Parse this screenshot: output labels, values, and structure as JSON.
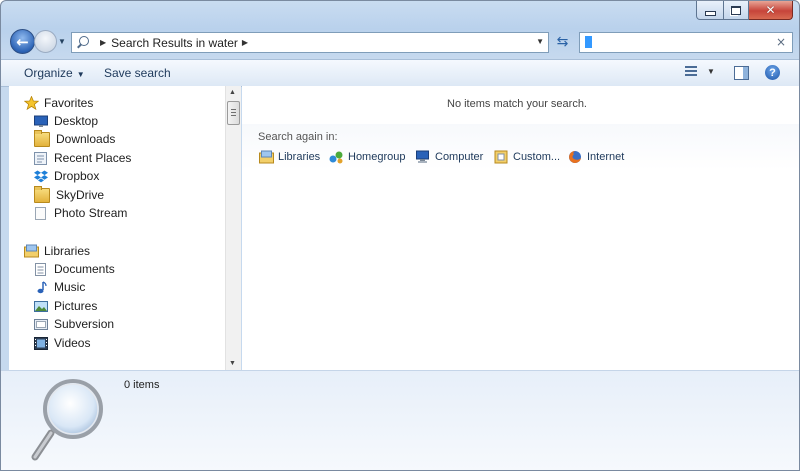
{
  "window": {
    "controls": {
      "minimize": "minimize",
      "maximize": "maximize",
      "close": "✕"
    }
  },
  "addressbar": {
    "breadcrumb": "Search Results in water",
    "search_value": ""
  },
  "toolbar": {
    "organize_label": "Organize",
    "save_search_label": "Save search"
  },
  "navigation": {
    "favorites_label": "Favorites",
    "favorites": [
      {
        "label": "Desktop",
        "icon": "desktop-icon"
      },
      {
        "label": "Downloads",
        "icon": "downloads-folder-icon"
      },
      {
        "label": "Recent Places",
        "icon": "recent-places-icon"
      },
      {
        "label": "Dropbox",
        "icon": "dropbox-icon"
      },
      {
        "label": "SkyDrive",
        "icon": "skydrive-folder-icon"
      },
      {
        "label": "Photo Stream",
        "icon": "photo-stream-icon"
      }
    ],
    "libraries_label": "Libraries",
    "libraries": [
      {
        "label": "Documents",
        "icon": "documents-icon"
      },
      {
        "label": "Music",
        "icon": "music-icon"
      },
      {
        "label": "Pictures",
        "icon": "pictures-icon"
      },
      {
        "label": "Subversion",
        "icon": "subversion-icon"
      },
      {
        "label": "Videos",
        "icon": "videos-icon"
      }
    ]
  },
  "content": {
    "empty_message": "No items match your search.",
    "search_again_label": "Search again in:",
    "search_again_items": [
      {
        "label": "Libraries",
        "icon": "libraries-icon"
      },
      {
        "label": "Homegroup",
        "icon": "homegroup-icon"
      },
      {
        "label": "Computer",
        "icon": "computer-icon"
      },
      {
        "label": "Custom...",
        "icon": "custom-folder-icon"
      },
      {
        "label": "Internet",
        "icon": "firefox-icon"
      }
    ]
  },
  "details": {
    "item_count": "0 items"
  },
  "colors": {
    "accent": "#1e395b",
    "title_bar": "#c9dcf1",
    "close_button": "#c7443a"
  }
}
